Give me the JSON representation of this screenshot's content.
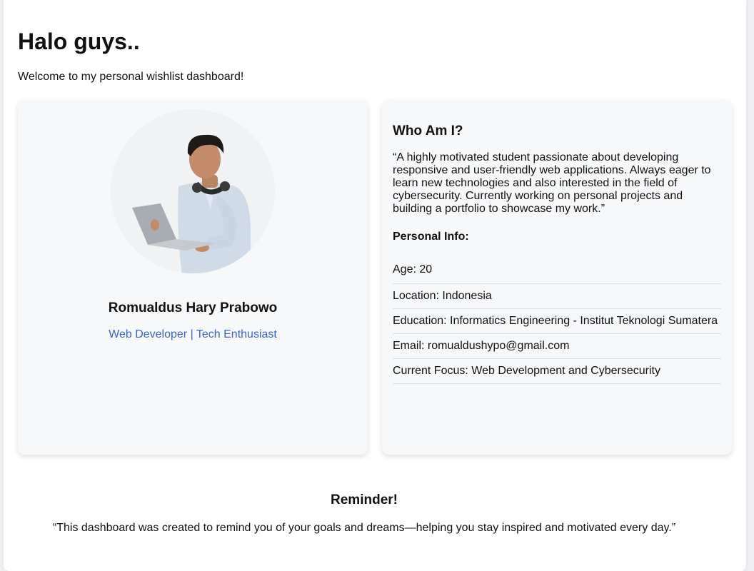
{
  "header": {
    "title": "Halo guys..",
    "subtitle": "Welcome to my personal wishlist dashboard!"
  },
  "profile": {
    "name": "Romualdus Hary Prabowo",
    "role": "Web Developer | Tech Enthusiast",
    "role_color": "#3a64cc"
  },
  "about": {
    "title": "Who Am I?",
    "quote": "“A highly motivated student passionate about developing responsive and user-friendly web applications. Always eager to learn new technologies and also interested in the field of cybersecurity. Currently working on personal projects and building a portfolio to showcase my work.”",
    "info_title": "Personal Info:",
    "info": [
      "Age: 20",
      "Location: Indonesia",
      "Education: Informatics Engineering - Institut Teknologi Sumatera",
      "Email: romualdushypo@gmail.com",
      "Current Focus: Web Development and Cybersecurity"
    ]
  },
  "reminder": {
    "title": "Reminder!",
    "text": "“This dashboard was created to remind you of your goals and dreams—helping you stay inspired and motivated every day.”"
  }
}
